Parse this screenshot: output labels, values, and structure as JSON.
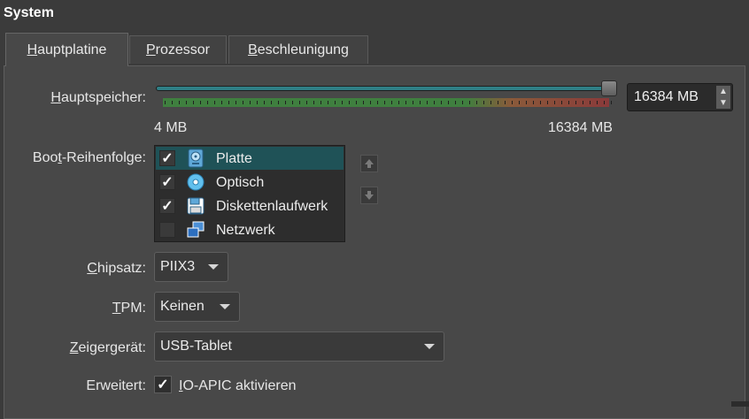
{
  "section": {
    "title": "System"
  },
  "tabs": [
    {
      "first": "H",
      "rest": "auptplatine",
      "active": true
    },
    {
      "first": "P",
      "rest": "rozessor",
      "active": false
    },
    {
      "first": "B",
      "rest": "eschleunigung",
      "active": false
    }
  ],
  "memory": {
    "label_first": "H",
    "label_rest": "auptspeicher:",
    "min_label": "4 MB",
    "max_label": "16384 MB",
    "value": "16384 MB",
    "fill_fraction": 1.0
  },
  "boot": {
    "label_pre": "Boo",
    "label_u": "t",
    "label_post": "-Reihenfolge:",
    "items": [
      {
        "label": "Platte",
        "checked": true,
        "selected": true,
        "icon": "hard-disk-icon"
      },
      {
        "label": "Optisch",
        "checked": true,
        "selected": false,
        "icon": "optical-disc-icon"
      },
      {
        "label": "Diskettenlaufwerk",
        "checked": true,
        "selected": false,
        "icon": "floppy-disk-icon"
      },
      {
        "label": "Netzwerk",
        "checked": false,
        "selected": false,
        "icon": "network-icon"
      }
    ],
    "check_mark": "✓"
  },
  "chipset": {
    "label_first": "C",
    "label_rest": "hipsatz:",
    "value": "PIIX3"
  },
  "tpm": {
    "label_first": "T",
    "label_rest": "PM:",
    "value": "Keinen"
  },
  "pointer": {
    "label_first": "Z",
    "label_rest": "eigergerät:",
    "value": "USB-Tablet"
  },
  "extended": {
    "label": "Erweitert:",
    "checkbox_first": "I",
    "checkbox_rest": "O-APIC aktivieren",
    "checked": true
  },
  "colors": {
    "accent": "#1f5257",
    "slider": "#2f7f86"
  }
}
